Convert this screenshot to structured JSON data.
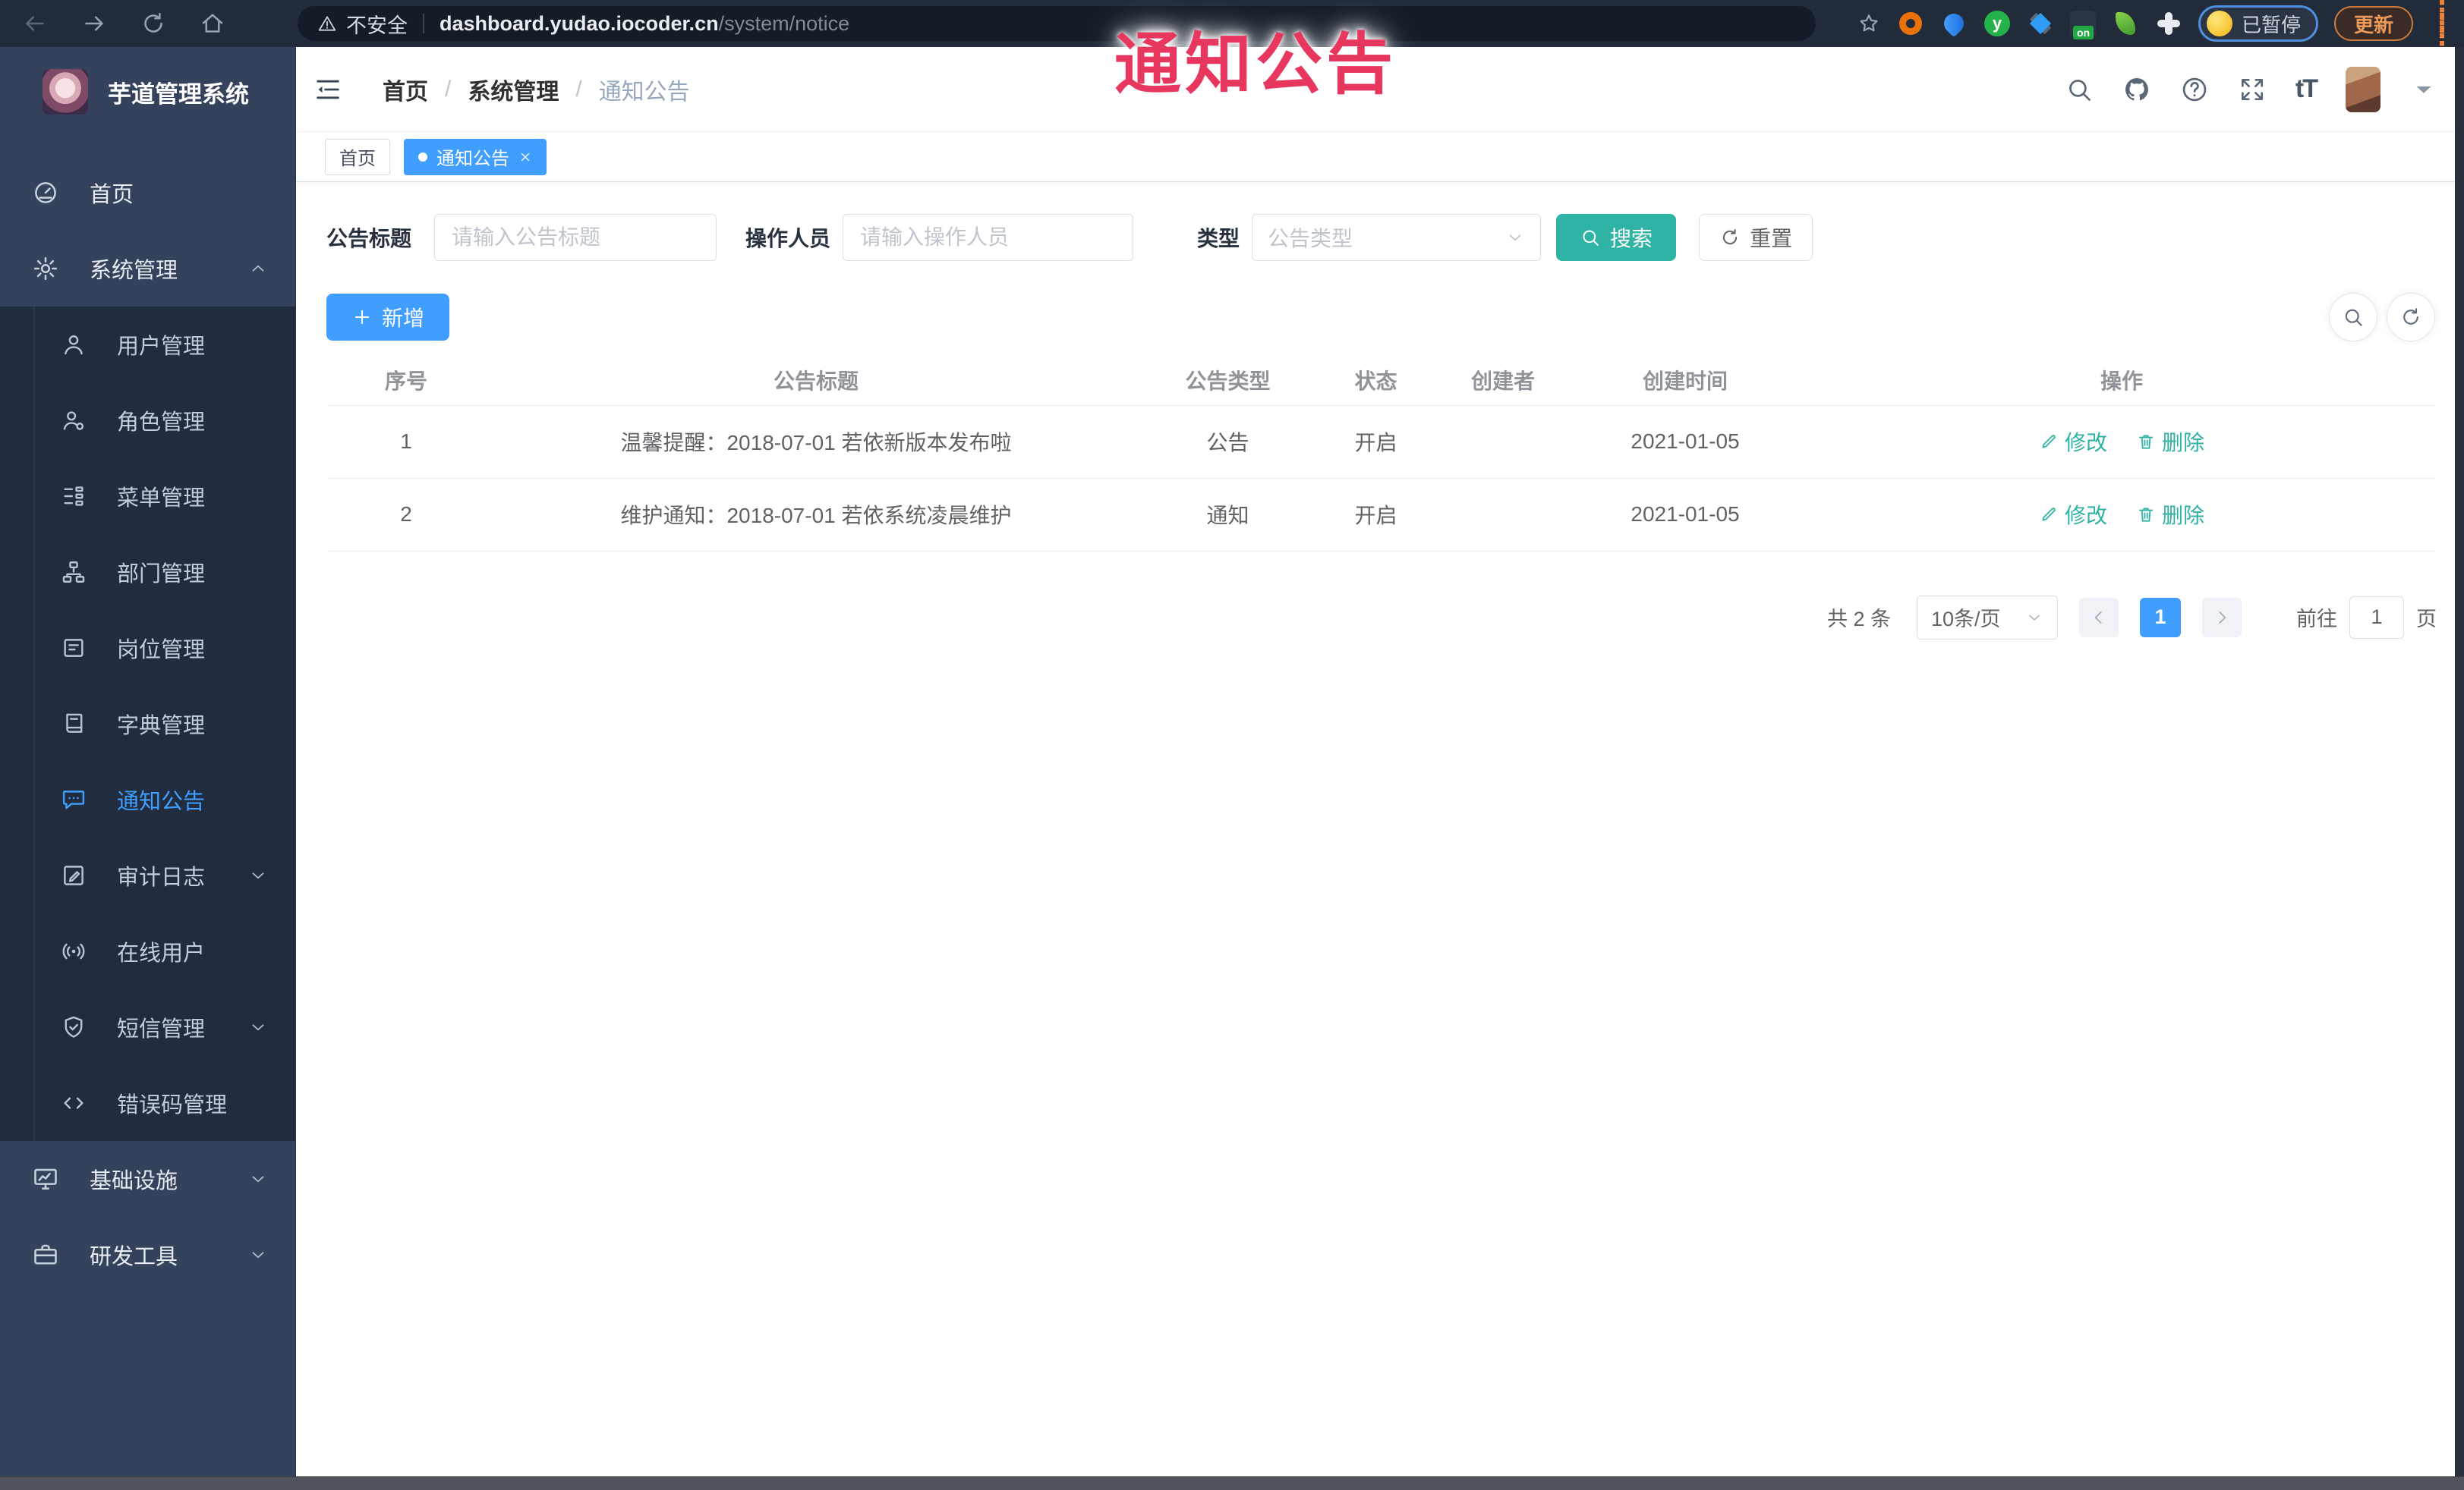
{
  "colors": {
    "accent": "#409eff",
    "teal": "#2fb3a4",
    "overlay_red": "#e8375f",
    "sidebar_bg": "#35425b",
    "submenu_bg": "#212c3f"
  },
  "overlay": {
    "text": "通知公告"
  },
  "browser": {
    "security_label": "不安全",
    "url_host": "dashboard.yudao.iocoder.cn",
    "url_path": "/system/notice",
    "profile_status": "已暂停",
    "update_label": "更新",
    "on_badge": "on"
  },
  "sidebar": {
    "title": "芋道管理系统",
    "menu": [
      {
        "id": "home",
        "label": "首页",
        "icon": "dashboard-icon"
      },
      {
        "id": "system",
        "label": "系统管理",
        "icon": "gear-icon",
        "chevron": "up",
        "children": [
          {
            "id": "user",
            "label": "用户管理",
            "icon": "user-icon"
          },
          {
            "id": "role",
            "label": "角色管理",
            "icon": "role-icon"
          },
          {
            "id": "menu",
            "label": "菜单管理",
            "icon": "menu-icon"
          },
          {
            "id": "dept",
            "label": "部门管理",
            "icon": "dept-icon"
          },
          {
            "id": "post",
            "label": "岗位管理",
            "icon": "post-icon"
          },
          {
            "id": "dict",
            "label": "字典管理",
            "icon": "dict-icon"
          },
          {
            "id": "notice",
            "label": "通知公告",
            "icon": "notice-icon",
            "active": true
          },
          {
            "id": "audit",
            "label": "审计日志",
            "icon": "audit-icon",
            "chevron": "down"
          },
          {
            "id": "online",
            "label": "在线用户",
            "icon": "online-icon"
          },
          {
            "id": "sms",
            "label": "短信管理",
            "icon": "sms-icon",
            "chevron": "down"
          },
          {
            "id": "errcode",
            "label": "错误码管理",
            "icon": "errcode-icon"
          }
        ]
      },
      {
        "id": "infra",
        "label": "基础设施",
        "icon": "infra-icon",
        "chevron": "down"
      },
      {
        "id": "devtools",
        "label": "研发工具",
        "icon": "tools-icon",
        "chevron": "down"
      }
    ]
  },
  "header": {
    "breadcrumb": [
      "首页",
      "系统管理",
      "通知公告"
    ]
  },
  "tags": [
    {
      "label": "首页",
      "active": false
    },
    {
      "label": "通知公告",
      "active": true,
      "closable": true
    }
  ],
  "filters": {
    "title_label": "公告标题",
    "title_placeholder": "请输入公告标题",
    "operator_label": "操作人员",
    "operator_placeholder": "请输入操作人员",
    "type_label": "类型",
    "type_placeholder": "公告类型",
    "search_label": "搜索",
    "reset_label": "重置"
  },
  "toolbar": {
    "add_label": "新增"
  },
  "table": {
    "columns": [
      "序号",
      "公告标题",
      "公告类型",
      "状态",
      "创建者",
      "创建时间",
      "操作"
    ],
    "rows": [
      {
        "no": "1",
        "title": "温馨提醒：2018-07-01 若依新版本发布啦",
        "type": "公告",
        "status": "开启",
        "creator": "",
        "created": "2021-01-05"
      },
      {
        "no": "2",
        "title": "维护通知：2018-07-01 若依系统凌晨维护",
        "type": "通知",
        "status": "开启",
        "creator": "",
        "created": "2021-01-05"
      }
    ],
    "edit_label": "修改",
    "delete_label": "删除"
  },
  "pagination": {
    "total": "共 2 条",
    "page_size": "10条/页",
    "current_page": "1",
    "goto_label": "前往",
    "goto_value": "1",
    "page_unit": "页"
  }
}
